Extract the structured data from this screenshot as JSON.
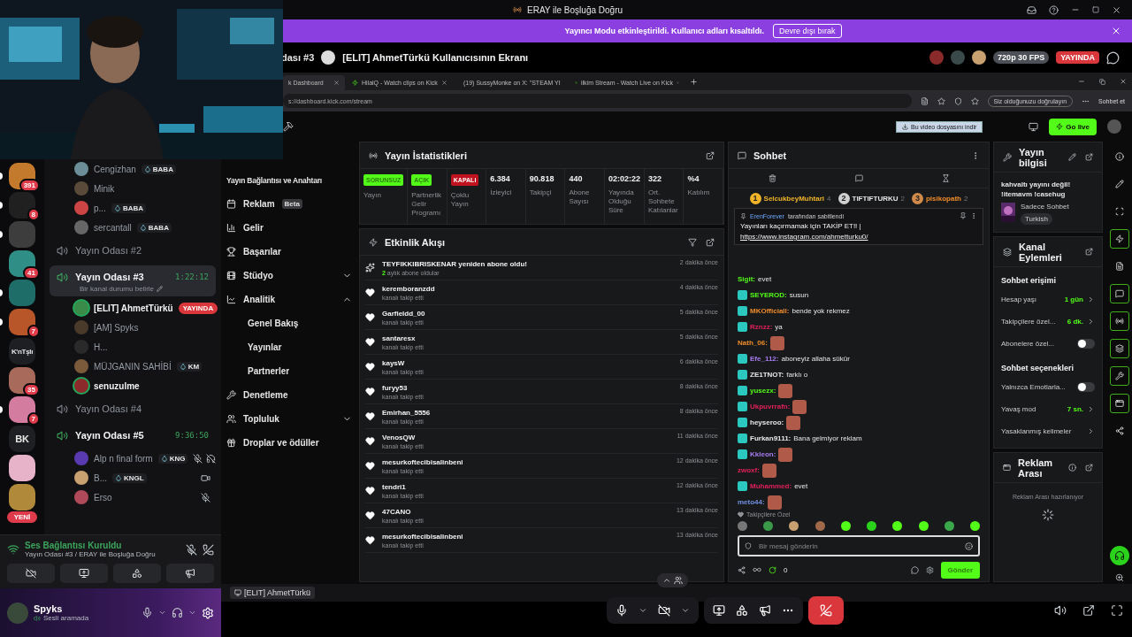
{
  "title_bar": {
    "title": "ERAY ile Boşluğa Doğru"
  },
  "banner": {
    "message": "Yayıncı Modu etkinleştirildi. Kullanıcı adları kısaltıldı.",
    "button": "Devre dışı bırak"
  },
  "stream_header": {
    "channel": "dası #3",
    "title": "[ELIT] AhmetTürkü Kullanıcısının Ekranı",
    "quality": "720p 30 FPS",
    "status": "YAYINDA"
  },
  "servers": [
    {
      "badge": "391",
      "color": "#c47a2c",
      "unread": true
    },
    {
      "badge": "8",
      "color": "#202020",
      "unread": true
    },
    {
      "color": "#3d3d3d",
      "unread": true
    },
    {
      "badge": "41",
      "color": "#2f8f86",
      "unread": false
    },
    {
      "color": "#1f6d68",
      "unread": true
    },
    {
      "badge": "7",
      "color": "#b8562a",
      "unread": true
    },
    {
      "label": "K'nTşlı",
      "unread": false
    },
    {
      "badge": "35",
      "color": "#a86a5a",
      "unread": false
    },
    {
      "badge": "7",
      "color": "#d47ba0",
      "unread": true
    },
    {
      "label": "BK",
      "unread": false
    },
    {
      "color": "#e7b3c9",
      "unread": false
    },
    {
      "color": "#b08a3a",
      "unread": false
    }
  ],
  "new_label": "YENİ",
  "channels": [
    {
      "members": [
        {
          "name": "Cengizhan",
          "tag": "BABA",
          "speaking": false,
          "muted": false,
          "deafened": false,
          "video": false
        },
        {
          "name": "Minik",
          "speaking": false,
          "muted": false,
          "deafened": false,
          "video": false
        },
        {
          "name": "p...",
          "tag": "BABA",
          "speaking": false,
          "muted": false,
          "deafened": false,
          "video": false
        },
        {
          "name": "sercantall",
          "tag": "BABA",
          "speaking": false,
          "muted": false,
          "deafened": false,
          "video": false
        }
      ]
    },
    {
      "name": "Yayın Odası #2",
      "selected": false
    },
    {
      "name": "Yayın Odası #3",
      "selected": true,
      "time": "1:22:12",
      "status": "Bir kanal durumu belirle",
      "members": [
        {
          "name": "[ELIT] AhmetTürkü",
          "live": "YAYINDA",
          "speaking": true,
          "muted": false,
          "deafened": false,
          "video": false
        },
        {
          "name": "[AM] Spyks",
          "speaking": false,
          "muted": false,
          "deafened": false,
          "video": false
        },
        {
          "name": "H...",
          "speaking": false,
          "muted": false,
          "deafened": false,
          "video": false
        },
        {
          "name": "MÜJGANIN SAHİBİ",
          "tag": "KM",
          "speaking": false,
          "muted": false,
          "deafened": false,
          "video": false
        },
        {
          "name": "senuzulme",
          "speaking": true,
          "muted": false,
          "deafened": false,
          "video": false
        }
      ]
    },
    {
      "name": "Yayın Odası #4",
      "selected": false
    },
    {
      "name": "Yayın Odası #5",
      "selected": false,
      "time": "9:36:50",
      "members": [
        {
          "name": "Alp n final form",
          "tag": "KNG",
          "speaking": false,
          "muted": true,
          "deafened": true,
          "video": false
        },
        {
          "name": "B...",
          "tag": "KNGL",
          "speaking": false,
          "muted": false,
          "deafened": false,
          "video": true
        },
        {
          "name": "Erso",
          "speaking": false,
          "muted": true,
          "deafened": false,
          "video": false
        }
      ]
    }
  ],
  "voice_panel": {
    "status": "Ses Bağlantısı Kuruldu",
    "location": "Yayın Odası #3 / ERAY ile Boşluğa Doğru"
  },
  "user": {
    "name": "Spyks",
    "status": "Sesli aramada"
  },
  "browser": {
    "tabs": [
      {
        "title": "k Dashboard",
        "selected": true
      },
      {
        "title": "HilalQ - Watch clips on Kick",
        "selected": false
      },
      {
        "title": "(19) SussyMonke on X: \"STEAM YI",
        "selected": false
      },
      {
        "title": "ilkim Stream - Watch Live on Kick",
        "selected": false
      }
    ],
    "url": "s://dashboard.kick.com/stream",
    "verify": "Siz olduğunuzu doğrulayın",
    "chat_button": "Sohbet et"
  },
  "kick_bar": {
    "download": "Bu video dosyasını indir",
    "go_live": "Go live"
  },
  "nav": [
    {
      "label": "Yayın Bağlantısı ve Anahtarı",
      "kind": "plain"
    },
    {
      "label": "Reklam",
      "badge": "Beta",
      "kind": "link"
    },
    {
      "label": "Gelir",
      "kind": "link"
    },
    {
      "label": "Başarılar",
      "kind": "link"
    },
    {
      "label": "Stüdyo",
      "kind": "group",
      "expanded": false
    },
    {
      "label": "Analitik",
      "kind": "group",
      "expanded": true,
      "children": [
        {
          "label": "Genel Bakış"
        },
        {
          "label": "Yayınlar"
        },
        {
          "label": "Partnerler"
        }
      ]
    },
    {
      "label": "Denetleme",
      "kind": "link"
    },
    {
      "label": "Topluluk",
      "kind": "group",
      "expanded": false
    },
    {
      "label": "Droplar ve ödüller",
      "kind": "link"
    }
  ],
  "stats": {
    "title": "Yayın İstatistikleri",
    "items": [
      {
        "kind": "ok",
        "value": "SORUNSUZ",
        "label": "Yayın"
      },
      {
        "kind": "ok",
        "value": "AÇIK",
        "label": "Partnerlik Gelir Programı"
      },
      {
        "kind": "off",
        "value": "KAPALI",
        "label": "Çoklu Yayın"
      },
      {
        "kind": "number",
        "value": "6.384",
        "label": "İzleyici"
      },
      {
        "kind": "number",
        "value": "90.818",
        "label": "Takipçi"
      },
      {
        "kind": "number",
        "value": "440",
        "label": "Abone Sayısı"
      },
      {
        "kind": "number",
        "value": "02:02:22",
        "label": "Yayında Olduğu Süre"
      },
      {
        "kind": "number",
        "value": "322",
        "label": "Ort. Sohbete Katılanlar"
      },
      {
        "kind": "number",
        "value": "%4",
        "label": "Katılım"
      }
    ]
  },
  "activity": {
    "title": "Etkinlik Akışı",
    "events": [
      {
        "kind": "sub",
        "name": "TEYFIKKIBRISKENAR yeniden abone oldu!",
        "detail": "**2** aylık abone oldular",
        "time": "2 dakika önce"
      },
      {
        "kind": "follow",
        "name": "keremboranzdd",
        "detail": "kanalı takip etti",
        "time": "4 dakika önce"
      },
      {
        "kind": "follow",
        "name": "Garfieldd_00",
        "detail": "kanalı takip etti",
        "time": "5 dakika önce"
      },
      {
        "kind": "follow",
        "name": "santaresx",
        "detail": "kanalı takip etti",
        "time": "5 dakika önce"
      },
      {
        "kind": "follow",
        "name": "kaysW",
        "detail": "kanalı takip etti",
        "time": "6 dakika önce"
      },
      {
        "kind": "follow",
        "name": "furyy53",
        "detail": "kanalı takip etti",
        "time": "8 dakika önce"
      },
      {
        "kind": "follow",
        "name": "Emirhan_5556",
        "detail": "kanalı takip etti",
        "time": "8 dakika önce"
      },
      {
        "kind": "follow",
        "name": "VenosQW",
        "detail": "kanalı takip etti",
        "time": "11 dakika önce"
      },
      {
        "kind": "follow",
        "name": "mesurkoftecibisalinbeni",
        "detail": "kanalı takip etti",
        "time": "12 dakika önce"
      },
      {
        "kind": "follow",
        "name": "tendri1",
        "detail": "kanalı takip etti",
        "time": "12 dakika önce"
      },
      {
        "kind": "follow",
        "name": "47CANO",
        "detail": "kanalı takip etti",
        "time": "13 dakika önce"
      },
      {
        "kind": "follow",
        "name": "mesurkoftecibisalinbeni",
        "detail": "kanalı takip etti",
        "time": "13 dakika önce"
      }
    ]
  },
  "chat": {
    "title": "Sohbet",
    "leaders": [
      {
        "rank": "1",
        "name": "SelcukbeyMuhtari",
        "count": "4"
      },
      {
        "rank": "2",
        "name": "TIFTIFTURKU",
        "count": "2"
      },
      {
        "rank": "3",
        "name": "pisikopath",
        "count": "2"
      }
    ],
    "pinned": {
      "by": "ErenForever",
      "note": "tarafından sabitlendi",
      "text": "Yayınları kaçırmamak için TAKİP ET!! |",
      "link": "https://www.instagram.com/ahmetturku0/"
    },
    "messages": [
      {
        "user": "Sigit:",
        "color": "#53fc18",
        "badge": false,
        "text": "evet"
      },
      {
        "user": "SEYEROD:",
        "color": "#53fc18",
        "badge": true,
        "text": "susun"
      },
      {
        "user": "MKOfficiall:",
        "color": "#f08c2a",
        "badge": true,
        "text": "bende yok rekmez"
      },
      {
        "user": "Rznzz:",
        "color": "#e0205a",
        "badge": true,
        "text": "ya"
      },
      {
        "user": "Nath_06:",
        "color": "#f08c2a",
        "badge": false,
        "emote": true
      },
      {
        "user": "Efe_112:",
        "color": "#a77cf0",
        "badge": true,
        "text": "aboneyiz allaha sükür"
      },
      {
        "user": "ZE1TNOT:",
        "color": "#e8e8e8",
        "badge": true,
        "text": "farklı o"
      },
      {
        "user": "yusezx:",
        "color": "#53fc18",
        "badge": true,
        "emote": true
      },
      {
        "user": "Ukpuvrrafn:",
        "color": "#e0205a",
        "badge": true,
        "emote": true
      },
      {
        "user": "heyseroo:",
        "color": "#e8e8e8",
        "badge": true,
        "emote": true
      },
      {
        "user": "Furkan9111:",
        "color": "#e8e8e8",
        "badge": true,
        "text": "Bana gelmiyor reklam"
      },
      {
        "user": "Kkleon:",
        "color": "#a77cf0",
        "badge": true,
        "emote": true
      },
      {
        "user": "zwoxf:",
        "color": "#e0205a",
        "badge": false,
        "emote": true
      },
      {
        "user": "Muhammed:",
        "color": "#e0205a",
        "badge": true,
        "text": "evet"
      },
      {
        "user": "meto44:",
        "color": "#6f8fe0",
        "badge": false,
        "emote": true
      }
    ],
    "followers_only": "Takipçilere Özel",
    "placeholder": "Bir mesaj gönderin",
    "count": "0",
    "send": "Gönder"
  },
  "stream_info": {
    "title": "Yayın bilgisi",
    "text": "kahvaltı yayını değil! !itemavm !casehug",
    "category": "Sadece Sohbet",
    "tag": "Turkish"
  },
  "channel_actions": {
    "title": "Kanal Eylemleri",
    "sections": [
      {
        "title": "Sohbet erişimi",
        "rows": [
          {
            "kind": "link",
            "label": "Hesap yaşı",
            "value": "1 gün"
          },
          {
            "kind": "link",
            "label": "Takipçilere özel...",
            "value": "6 dk."
          },
          {
            "kind": "toggle",
            "label": "Abonelere özel...",
            "on": false
          }
        ]
      },
      {
        "title": "Sohbet seçenekleri",
        "rows": [
          {
            "kind": "toggle",
            "label": "Yalnızca Emotlarla...",
            "on": false
          },
          {
            "kind": "link",
            "label": "Yavaş mod",
            "value": "7 sn."
          },
          {
            "kind": "link",
            "label": "Yasaklanmış kelimeler"
          }
        ]
      }
    ]
  },
  "ad_break": {
    "title": "Reklam Arası",
    "status": "Reklam Arası hazırlanıyor"
  },
  "panel_rail": [
    {
      "on": false
    },
    {
      "on": false
    },
    {
      "on": false
    },
    {
      "on": true
    },
    {
      "on": false
    },
    {
      "on": true
    },
    {
      "on": true
    },
    {
      "on": true
    },
    {
      "on": true
    },
    {
      "on": true
    },
    {
      "on": false
    }
  ],
  "stream_label": "[ELIT] AhmetTürkü"
}
